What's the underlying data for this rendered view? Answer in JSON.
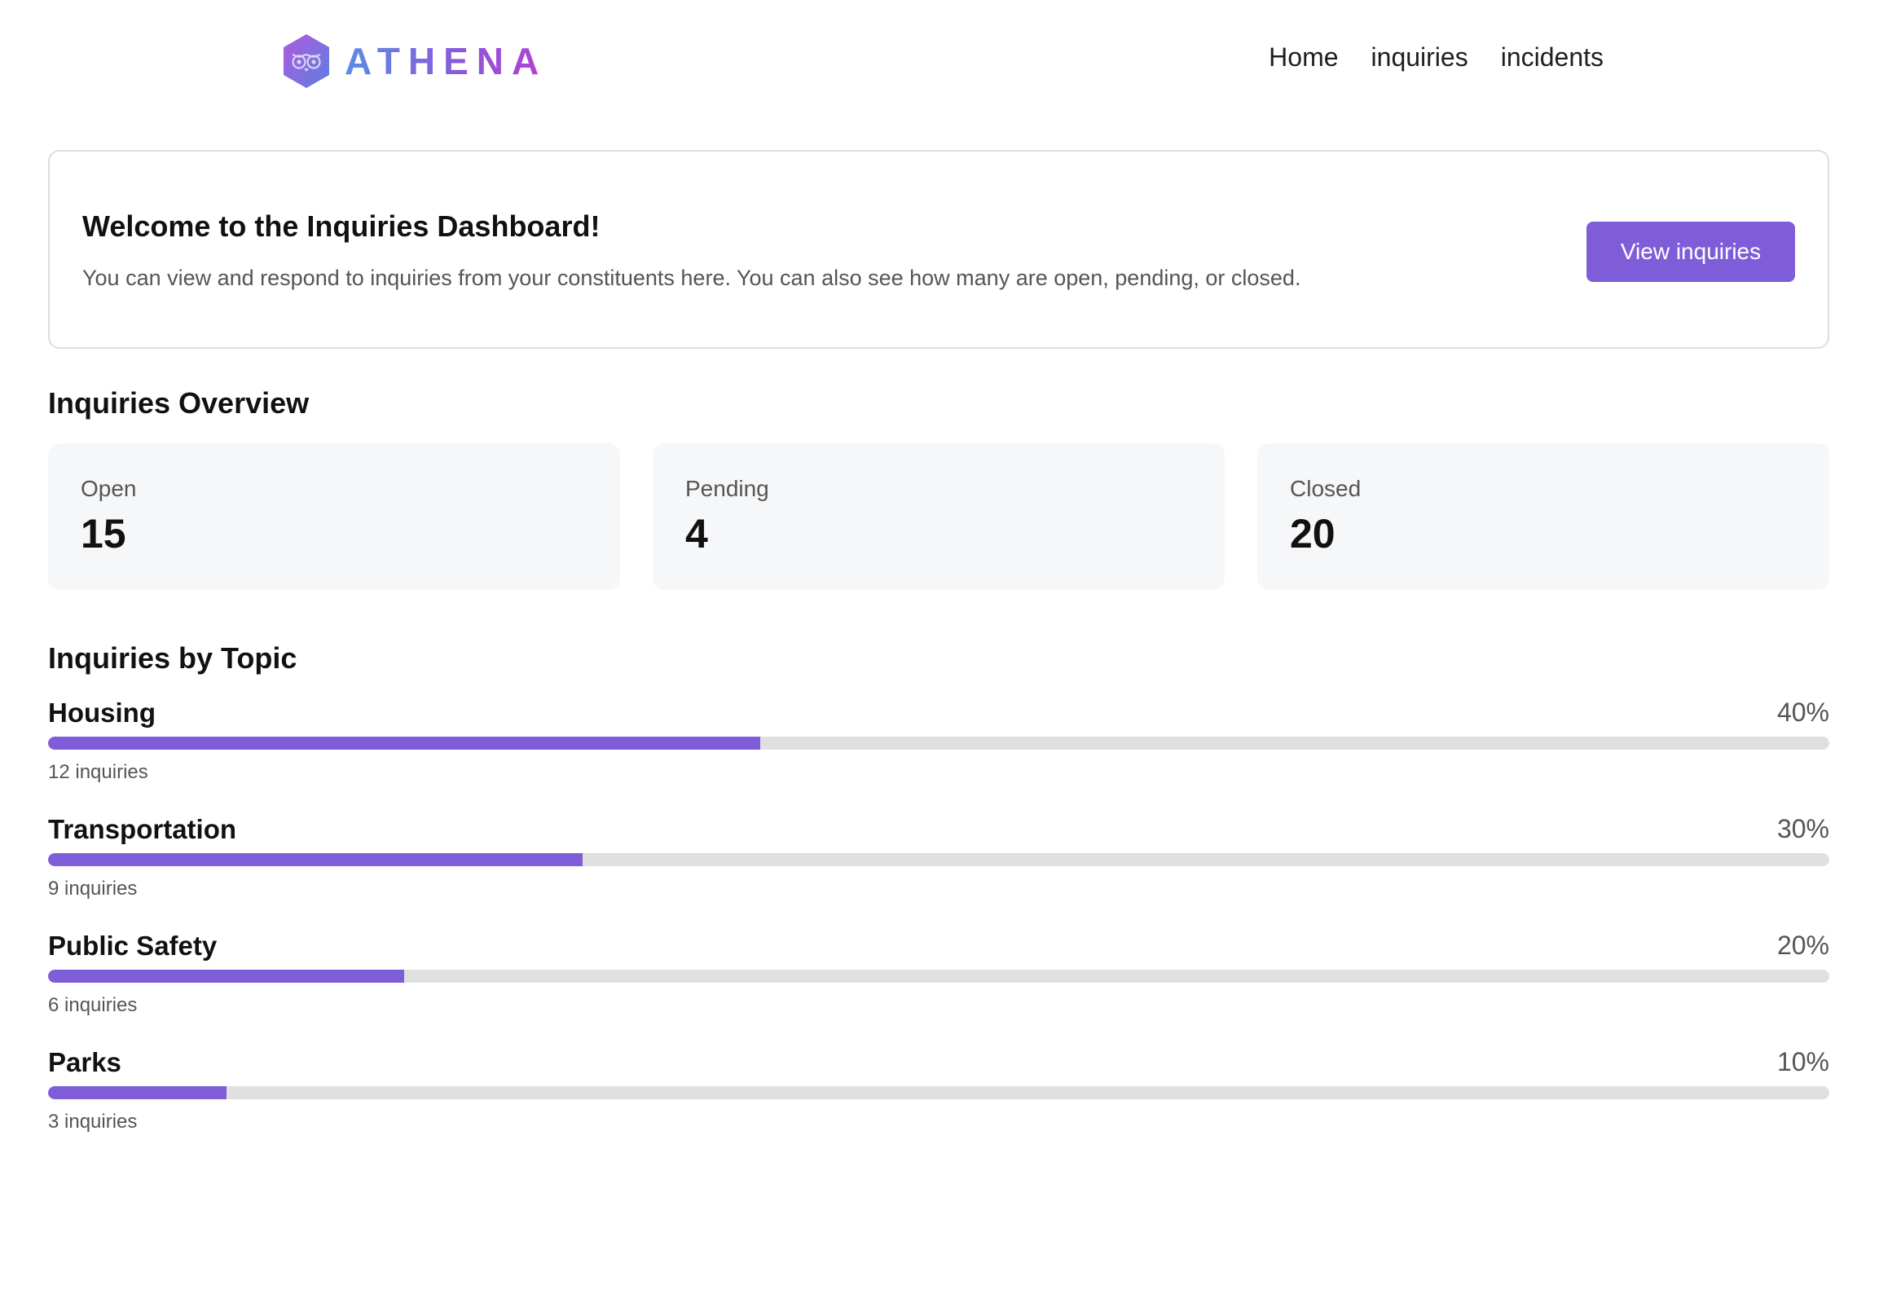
{
  "brand": {
    "name": "ATHENA",
    "icon": "owl-hexagon-icon",
    "gradient": [
      "#5b8de6",
      "#8a5ad9",
      "#b43fd6"
    ]
  },
  "nav": {
    "items": [
      "Home",
      "inquiries",
      "incidents"
    ]
  },
  "welcome": {
    "title": "Welcome to the Inquiries Dashboard!",
    "text": "You can view and respond to inquiries from your constituents here. You can also see how many are open, pending, or closed.",
    "button_label": "View inquiries"
  },
  "overview": {
    "title": "Inquiries Overview",
    "stats": [
      {
        "label": "Open",
        "value": "15"
      },
      {
        "label": "Pending",
        "value": "4"
      },
      {
        "label": "Closed",
        "value": "20"
      }
    ]
  },
  "topics": {
    "title": "Inquiries by Topic",
    "items": [
      {
        "name": "Housing",
        "percent_label": "40%",
        "percent": 40,
        "count_label": "12 inquiries"
      },
      {
        "name": "Transportation",
        "percent_label": "30%",
        "percent": 30,
        "count_label": "9 inquiries"
      },
      {
        "name": "Public Safety",
        "percent_label": "20%",
        "percent": 20,
        "count_label": "6 inquiries"
      },
      {
        "name": "Parks",
        "percent_label": "10%",
        "percent": 10,
        "count_label": "3 inquiries"
      }
    ]
  },
  "colors": {
    "accent": "#7f5dd9",
    "track": "#e0e0e0",
    "card_bg": "#f6f7f9",
    "muted_text": "#555555"
  }
}
